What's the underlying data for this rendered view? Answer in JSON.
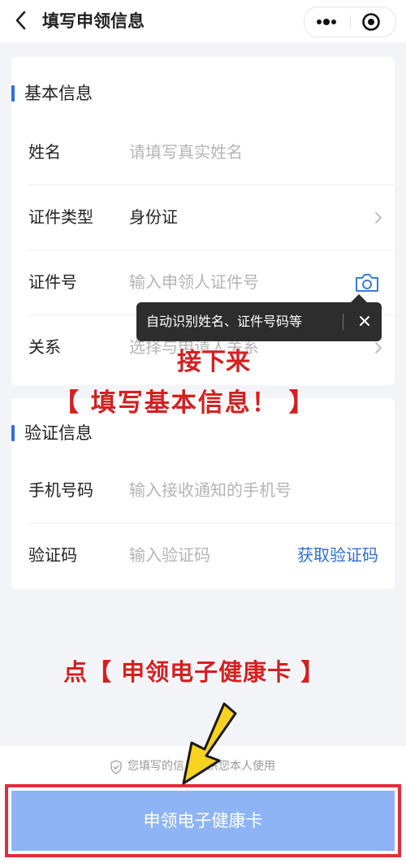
{
  "header": {
    "title": "填写申领信息"
  },
  "basic_section": {
    "title": "基本信息",
    "rows": [
      {
        "label": "姓名",
        "placeholder": "请填写真实姓名"
      },
      {
        "label": "证件类型",
        "value": "身份证"
      },
      {
        "label": "证件号",
        "placeholder": "输入申领人证件号"
      },
      {
        "label": "关系",
        "placeholder": "选择与申请人关系"
      }
    ]
  },
  "tooltip": {
    "text": "自动识别姓名、证件号码等"
  },
  "verify_section": {
    "title": "验证信息",
    "rows": [
      {
        "label": "手机号码",
        "placeholder": "输入接收通知的手机号"
      },
      {
        "label": "验证码",
        "placeholder": "输入验证码",
        "action": "获取验证码"
      }
    ]
  },
  "annotations": {
    "line1": "接下来",
    "line2": "【 填写基本信息！ 】",
    "line3": "点【 申领电子健康卡 】"
  },
  "footer": {
    "note": "您填写的信息仅供您本人使用",
    "button_label": "申领电子健康卡"
  },
  "colors": {
    "accent": "#2f6fe8",
    "button": "#8fb4f6",
    "annotation_red": "#d61f1f",
    "annotation_arrow": "#f7d31f"
  }
}
